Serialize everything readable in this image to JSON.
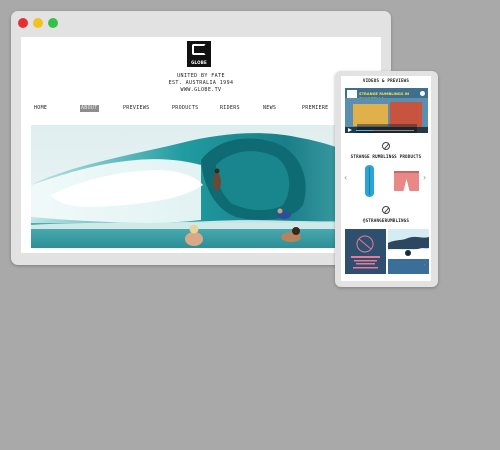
{
  "window_controls": {
    "close_color": "#e4312f",
    "minimize_color": "#f2c122",
    "maximize_color": "#35c148"
  },
  "site": {
    "logo_text": "GLOBE",
    "tagline": [
      "UNITED BY FATE",
      "EST. AUSTRALIA 1994",
      "WWW.GLOBE.TV"
    ],
    "nav": [
      "HOME",
      "ABOUT",
      "PREVIEWS",
      "PRODUCTS",
      "RIDERS",
      "NEWS",
      "PREMIERE"
    ],
    "active_nav": "ABOUT",
    "hero_image": "surfing-barrel-wave-photo"
  },
  "mobile": {
    "videos_title": "VIDEOS & PREVIEWS",
    "video_title": "STRANGE RUMBLINGS IN SHANGRI-LA",
    "products_title": "STRANGE RUMBLINGS PRODUCTS",
    "instagram_title": "@STRANGERUMBLINGS",
    "products": [
      "skateboard",
      "boardshorts"
    ]
  }
}
